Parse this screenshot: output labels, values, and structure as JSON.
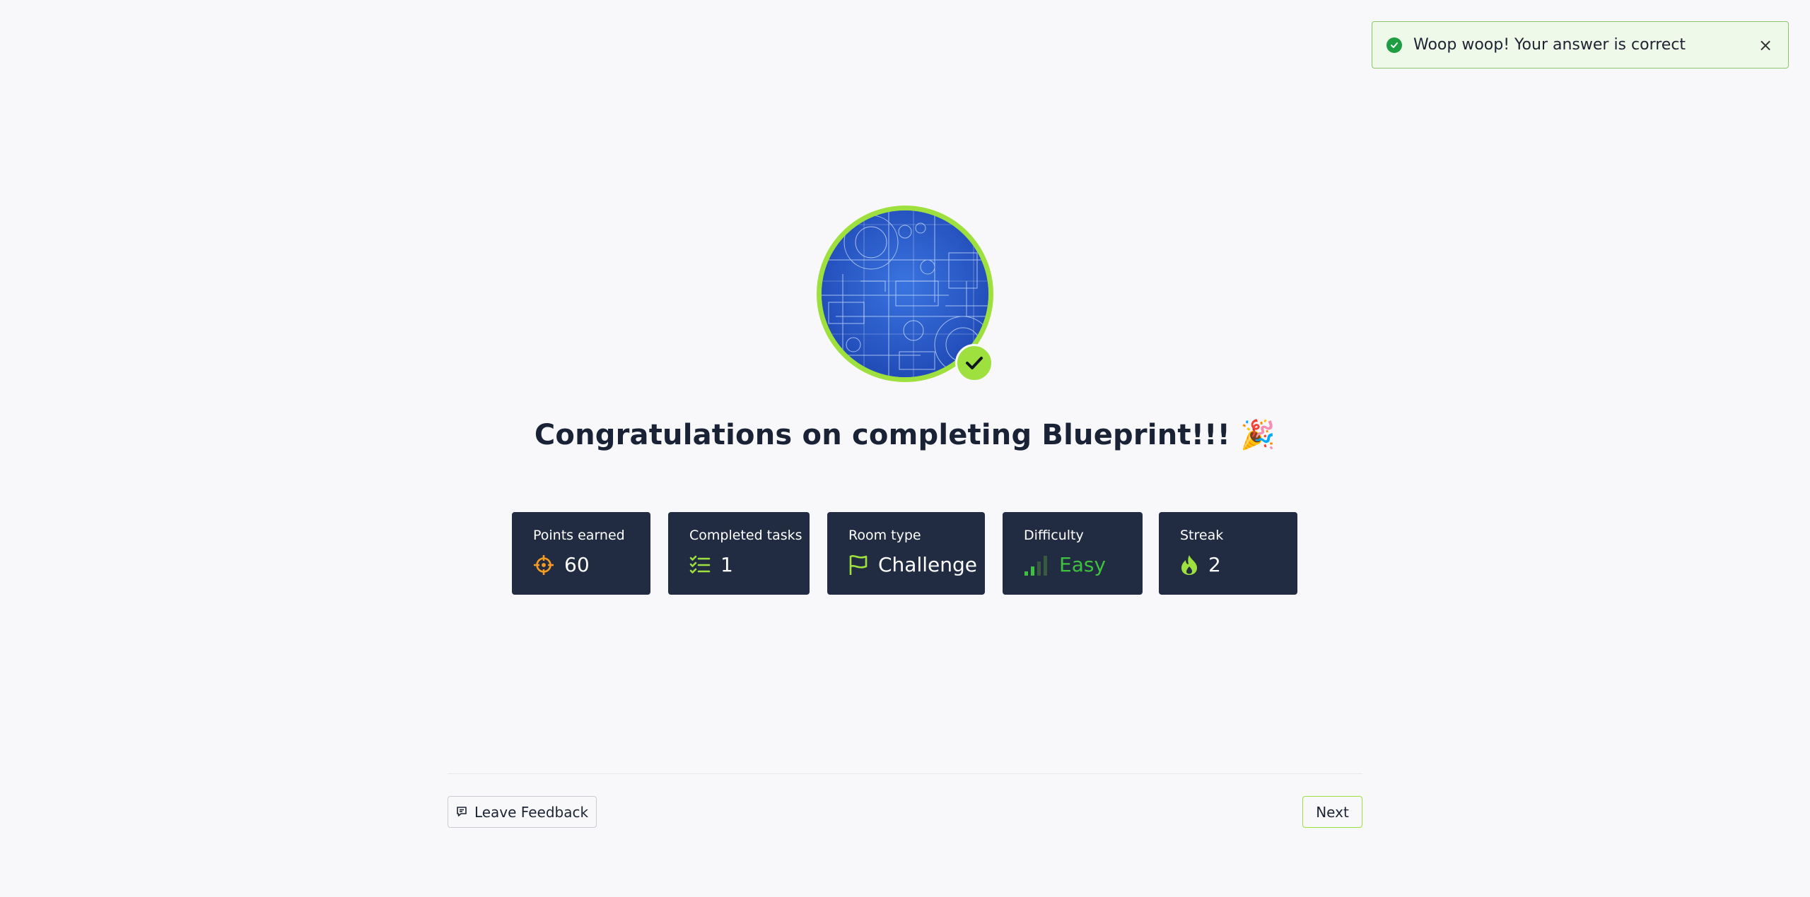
{
  "toast": {
    "message": "Woop woop! Your answer is correct",
    "close_icon": "×",
    "status_color": "#1f9d43"
  },
  "room": {
    "image": "blueprint-schematic",
    "completed": true
  },
  "congrats": {
    "text": "Congratulations on completing Blueprint!!! 🎉"
  },
  "stats": {
    "points": {
      "label": "Points earned",
      "value": "60",
      "icon": "crosshair-icon"
    },
    "tasks": {
      "label": "Completed tasks",
      "value": "1",
      "icon": "task-list-icon"
    },
    "room_type": {
      "label": "Room type",
      "value": "Challenge",
      "icon": "flag-icon"
    },
    "difficulty": {
      "label": "Difficulty",
      "value": "Easy",
      "icon": "signal-bars-icon"
    },
    "streak": {
      "label": "Streak",
      "value": "2",
      "icon": "flame-icon"
    }
  },
  "footer": {
    "feedback_label": "Leave Feedback",
    "next_label": "Next"
  },
  "colors": {
    "accent": "#9ee03e",
    "card_bg": "#212c42",
    "easy": "#3ec23e",
    "points_icon": "#f39c1f"
  }
}
